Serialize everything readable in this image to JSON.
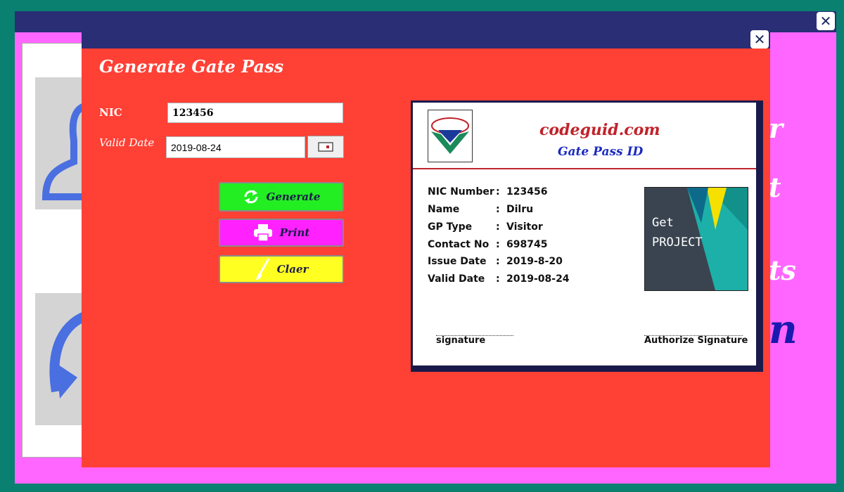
{
  "background_window": {
    "text_fragments": [
      "r",
      "t",
      "ts",
      "n"
    ]
  },
  "dialog": {
    "title": "Generate Gate Pass",
    "nic_label": "NIC",
    "nic_value": "123456",
    "valid_date_label": "Valid Date",
    "valid_date_value": "2019-08-24",
    "buttons": {
      "generate": "Generate",
      "print": "Print",
      "clear": "Claer"
    }
  },
  "card": {
    "site": "codeguid.com",
    "subtitle": "Gate Pass ID",
    "rows": [
      {
        "label": "NIC Number",
        "value": "123456"
      },
      {
        "label": "Name",
        "value": "Dilru"
      },
      {
        "label": "GP Type",
        "value": "Visitor"
      },
      {
        "label": "Contact No",
        "value": "698745"
      },
      {
        "label": "Issue Date",
        "value": "2019-8-20"
      },
      {
        "label": "Valid Date",
        "value": "2019-08-24"
      }
    ],
    "photo_text": [
      "Get",
      "PROJECT"
    ],
    "signature_left": "signature",
    "signature_right": "Authorize Signature"
  },
  "colors": {
    "dialog_bg": "#ff4035",
    "titlebar": "#2a2e74",
    "background_window": "#ff66ff",
    "generate_btn": "#22ee22",
    "print_btn": "#ff22ff",
    "clear_btn": "#ffff22"
  },
  "icons": [
    "close-icon",
    "calendar-icon",
    "refresh-icon",
    "printer-icon",
    "brush-icon",
    "user-icon",
    "logo-icon"
  ]
}
